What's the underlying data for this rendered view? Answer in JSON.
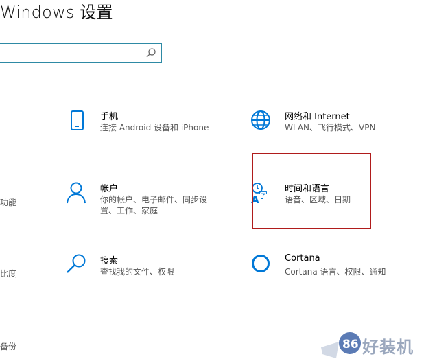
{
  "header": {
    "title": "Windows 设置"
  },
  "search": {
    "value": "",
    "placeholder": ""
  },
  "left_partial": {
    "row2_desc": "功能",
    "row3_desc": "比度",
    "row4_desc": "备份"
  },
  "tiles": {
    "phone": {
      "name": "手机",
      "desc1": "连接 Android 设备和 iPhone",
      "icon": "phone-icon"
    },
    "network": {
      "name": "网络和 Internet",
      "desc1": "WLAN、飞行模式、VPN",
      "icon": "globe-icon"
    },
    "accounts": {
      "name": "帐户",
      "desc1": "你的帐户、电子邮件、同步设",
      "desc2": "置、工作、家庭",
      "icon": "person-icon"
    },
    "time": {
      "name": "时间和语言",
      "desc1": "语音、区域、日期",
      "icon": "time-language-icon"
    },
    "search": {
      "name": "搜索",
      "desc1": "查找我的文件、权限",
      "icon": "magnifier-icon"
    },
    "cortana": {
      "name": "Cortana",
      "desc1": "Cortana 语言、权限、通知",
      "icon": "cortana-ring-icon"
    }
  },
  "watermark": {
    "text": "好装机",
    "logo_text": "86"
  },
  "colors": {
    "accent": "#0078d7",
    "search_border": "#2e8aa5",
    "highlight": "#b01c1c"
  }
}
